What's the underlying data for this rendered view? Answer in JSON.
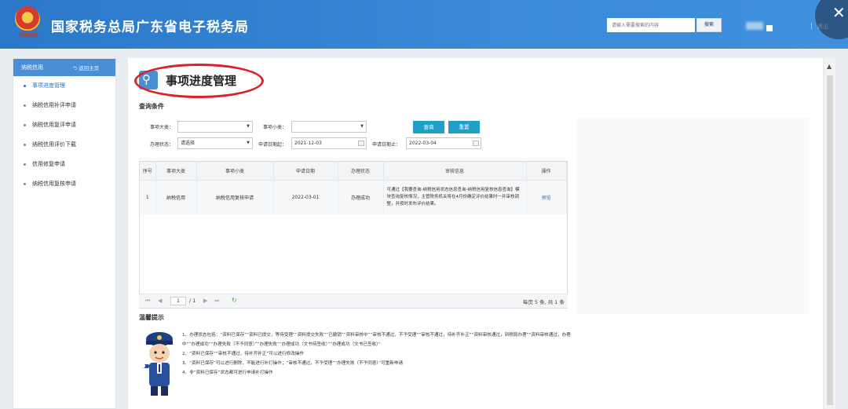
{
  "header": {
    "title": "国家税务总局广东省电子税务局",
    "emblem_caption": "中国税务",
    "search_placeholder": "请输入需要搜索的内容",
    "search_button": "搜索",
    "separator": "|",
    "logout": "退出",
    "close_glyph": "✕"
  },
  "sidebar": {
    "header": "纳税信用",
    "home_link": "返回主页",
    "items": [
      {
        "label": "事项进度管理",
        "active": true
      },
      {
        "label": "纳税信用补评申请"
      },
      {
        "label": "纳税信用复评申请"
      },
      {
        "label": "纳税信用评价下载"
      },
      {
        "label": "信用修复申请"
      },
      {
        "label": "纳税信用复核申请"
      }
    ]
  },
  "main": {
    "page_title": "事项进度管理",
    "query_title": "查询条件",
    "labels": {
      "category": "事项大类：",
      "subcategory": "事项小类：",
      "status": "办理状态：",
      "date_from": "申请日期起：",
      "date_to": "申请日期止："
    },
    "values": {
      "category": "",
      "subcategory": "",
      "status": "请选择",
      "date_from": "2021-12-03",
      "date_to": "2022-03-04"
    },
    "buttons": {
      "query": "查询",
      "reset": "重置"
    },
    "table": {
      "headers": [
        "序号",
        "事项大类",
        "事项小类",
        "申请日期",
        "办理状态",
        "审核信息",
        "操作"
      ],
      "row": {
        "index": "1",
        "category": "纳税信用",
        "subcategory": "纳税信用复核申请",
        "date": "2022-03-01",
        "status": "办理成功",
        "info": "可通过【我要查询-纳税信用状态信息查询-纳税信用复核信息查询】模块查询复核情况，主管税务机关将在4月份确定评价结果时一并审核调整，并按时发布评价结果。",
        "action": "预览"
      }
    },
    "pager": {
      "first": "⏮",
      "prev": "◀",
      "page": "1",
      "total": "/ 1",
      "next": "▶",
      "last": "⏭",
      "refresh": "↻",
      "summary": "每页 5 条, 共 1 条"
    },
    "tips_title": "温馨提示",
    "tips": [
      "1、办理状态包括：“资料已保存”“资料已提交，等待受理”“资料提交失败”“已撤销”“资料审核中”“审核不通过，不予受理”“审核不通过，待补齐补正”“资料审核通过，到税局办理”“资料审核通过，办理中”“办理成功”“办理失败（不予同意）”“办理失败”“办理成功（文书待签收）”“办理成功（文书已签收）”",
      "2、“资料已保存”“审核不通过，待补齐补正”可以进行修改操作",
      "3、“资料已保存”可以进行删除，不能进行补打操作；“审核不通过，不予受理”“办理失败（不予同意）”可重新申请",
      "4、非“资料已保存”状态都可进行申请补打操作"
    ]
  }
}
